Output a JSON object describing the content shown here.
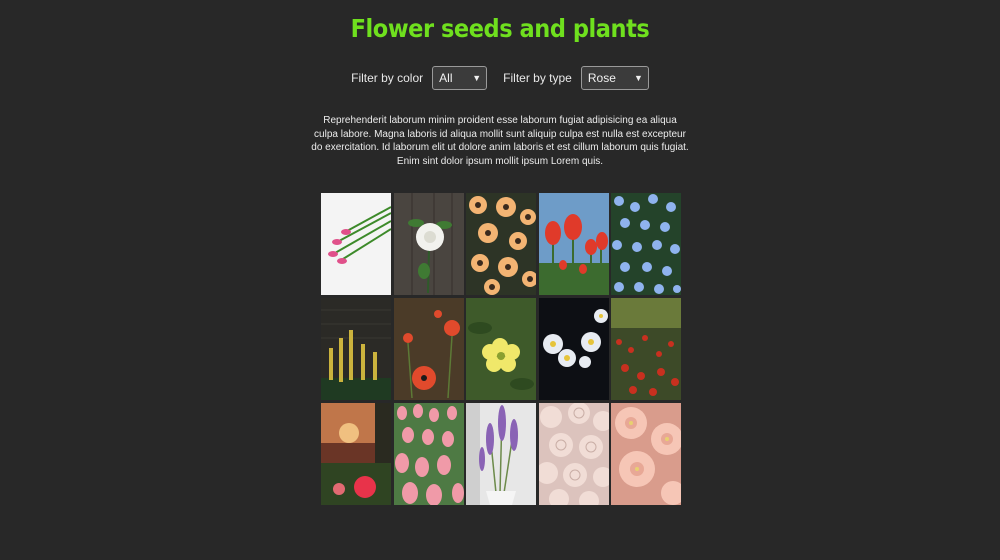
{
  "page": {
    "title": "Flower seeds and plants"
  },
  "filters": {
    "color_label": "Filter by color",
    "color_value": "All",
    "type_label": "Filter by type",
    "type_value": "Rose"
  },
  "description": "Reprehenderit laborum minim proident esse laborum fugiat adipisicing ea aliqua culpa labore. Magna laboris id aliqua mollit sunt aliquip culpa est nulla est excepteur do exercitation. Id laborum elit ut dolore anim laboris et est cillum laborum quis fugiat. Enim sint dolor ipsum mollit ipsum Lorem quis.",
  "colors": {
    "title": "#6fe01e",
    "background": "#282828"
  },
  "gallery": {
    "photos": [
      {
        "subject": "pink tulips bouquet on white",
        "bg": "#f4f4f4",
        "accent": "#e0508a"
      },
      {
        "subject": "white rose on wooden planks",
        "bg": "#4a4540",
        "accent": "#f2f2ee"
      },
      {
        "subject": "orange daisies",
        "bg": "#2d3426",
        "accent": "#f3b473"
      },
      {
        "subject": "red tulips against sky",
        "bg": "#6e9cc8",
        "accent": "#e03a2a"
      },
      {
        "subject": "blue flower field",
        "bg": "#24432a",
        "accent": "#8fb3ee"
      },
      {
        "subject": "yellow flowers by stone wall",
        "bg": "#2b2a26",
        "accent": "#cbb33d"
      },
      {
        "subject": "red poppies",
        "bg": "#4b3b28",
        "accent": "#e14a2c"
      },
      {
        "subject": "yellow primrose",
        "bg": "#3e5a2a",
        "accent": "#f0e86a"
      },
      {
        "subject": "white daisies on black",
        "bg": "#0d0f14",
        "accent": "#e8ecf2"
      },
      {
        "subject": "poppy meadow",
        "bg": "#3d4a28",
        "accent": "#c8301f"
      },
      {
        "subject": "red rose at sunset",
        "bg": "#6a3526",
        "accent": "#e8334a"
      },
      {
        "subject": "pink tulip field",
        "bg": "#4e7a44",
        "accent": "#f09aa8"
      },
      {
        "subject": "purple lavender",
        "bg": "#e7e7e7",
        "accent": "#8a63b5"
      },
      {
        "subject": "pale pink roses",
        "bg": "#dcc3bd",
        "accent": "#f1ddd6"
      },
      {
        "subject": "peach peonies",
        "bg": "#d99c8c",
        "accent": "#f6c6b6"
      }
    ]
  }
}
